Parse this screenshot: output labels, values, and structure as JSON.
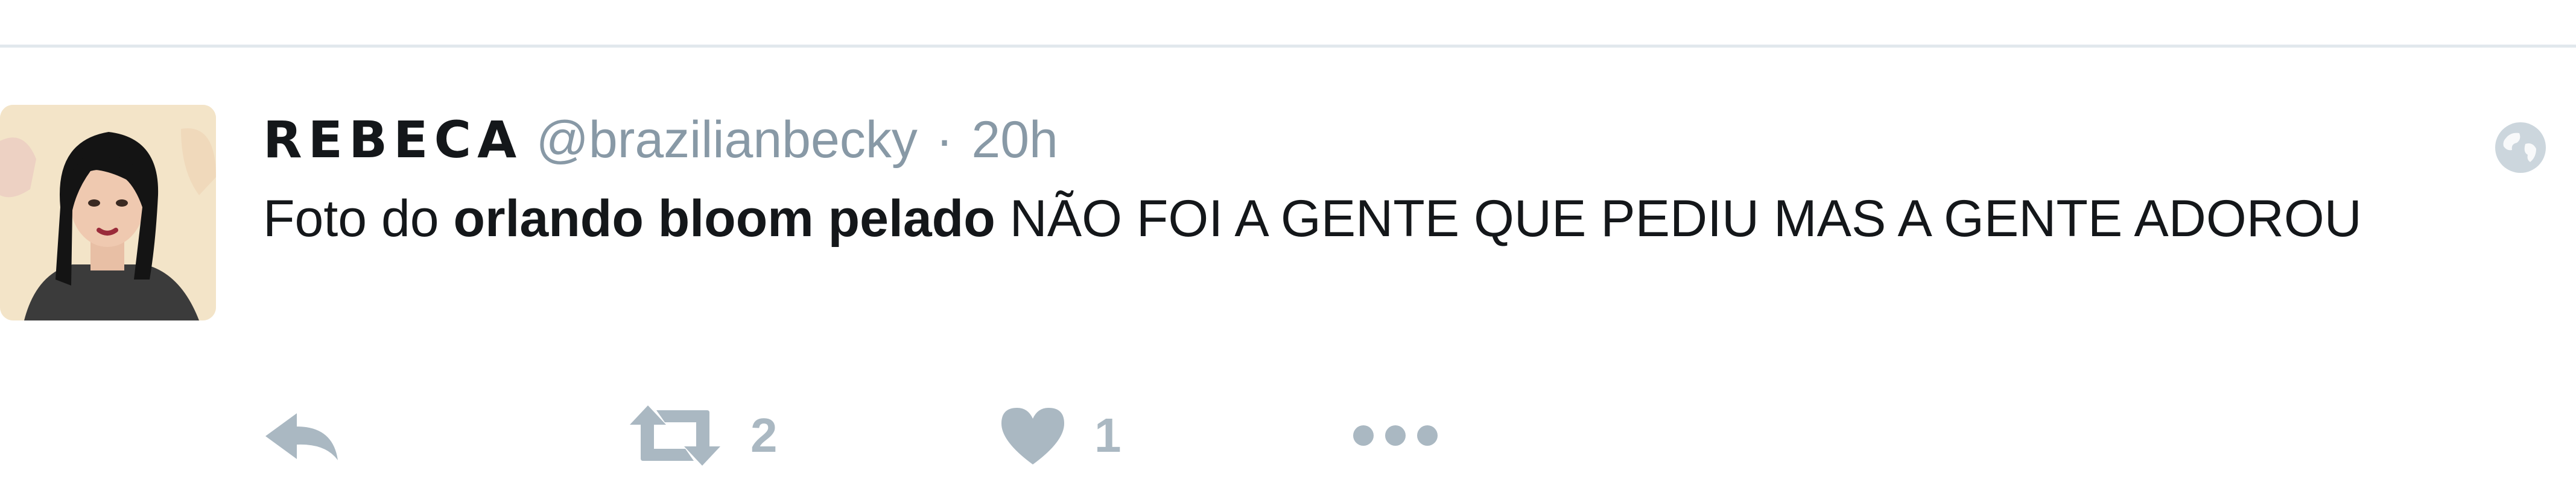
{
  "tweet": {
    "display_name": "REBECA",
    "username": "@brazilianbecky",
    "separator": "·",
    "time": "20h",
    "text_before": "Foto do ",
    "text_bold": "orlando bloom pelado",
    "text_after": " NÃO FOI A GENTE QUE PEDIU MAS A GENTE ADOROU",
    "actions": {
      "reply_icon": "reply-icon",
      "retweet_icon": "retweet-icon",
      "retweet_count": "2",
      "like_icon": "heart-icon",
      "like_count": "1",
      "more_icon": "more-dots-icon"
    },
    "globe_icon": "globe-icon"
  },
  "colors": {
    "text": "#14171a",
    "secondary": "#8899a6",
    "action_gray": "#aab8c2",
    "divider": "#e1e8ed"
  }
}
